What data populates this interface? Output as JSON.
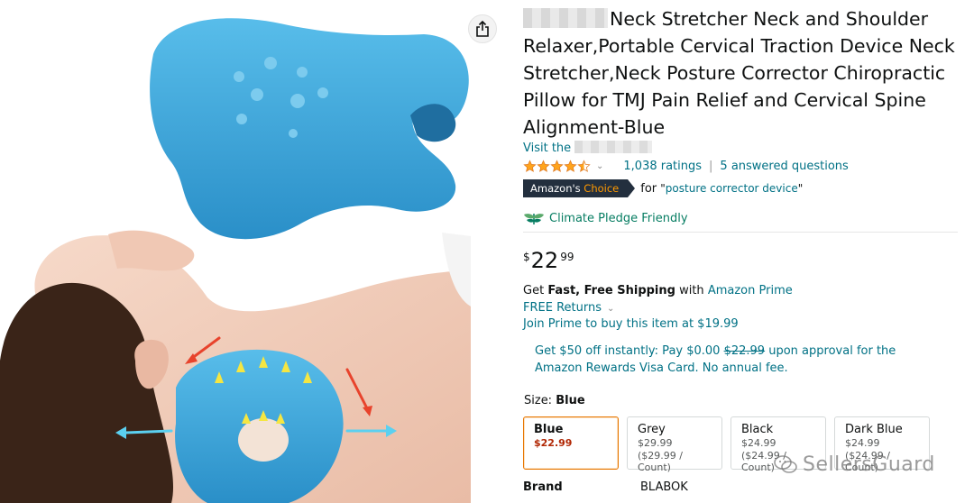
{
  "product": {
    "title": "Neck Stretcher Neck and Shoulder Relaxer,Portable Cervical Traction Device Neck Stretcher,Neck Posture Corrector Chiropractic Pillow for TMJ Pain Relief and Cervical Spine Alignment-Blue",
    "visit_store_prefix": "Visit the",
    "rating_stars": 4.5,
    "ratings_count": "1,038 ratings",
    "answered_questions": "5 answered questions",
    "choice_badge": {
      "prefix": "Amazon's",
      "highlight": "Choice"
    },
    "choice_for": "for",
    "choice_keyword": "posture corrector device",
    "pledge": "Climate Pledge Friendly",
    "price": {
      "symbol": "$",
      "whole": "22",
      "fraction": "99"
    },
    "shipping": {
      "get": "Get",
      "fast_free": "Fast, Free Shipping",
      "with": "with",
      "prime": "Amazon Prime"
    },
    "free_returns": "FREE Returns",
    "join_prime": "Join Prime to buy this item at $19.99",
    "promo": {
      "part1": "Get $50 off instantly: Pay $0.00",
      "strike": "$22.99",
      "part2": "upon approval for the Amazon Rewards Visa Card. No annual fee."
    },
    "size": {
      "label": "Size:",
      "value": "Blue"
    },
    "swatches": [
      {
        "name": "Blue",
        "price": "$22.99",
        "sub": "",
        "selected": true
      },
      {
        "name": "Grey",
        "price": "$29.99",
        "sub": "($29.99 / Count)",
        "selected": false
      },
      {
        "name": "Black",
        "price": "$24.99",
        "sub": "($24.99 / Count)",
        "selected": false
      },
      {
        "name": "Dark Blue",
        "price": "$24.99",
        "sub": "($24.99 / Count)",
        "selected": false
      }
    ],
    "brand": {
      "label": "Brand",
      "value": "BLABOK"
    }
  },
  "watermark": "SellersGuard",
  "colors": {
    "link": "#007185",
    "price_red": "#B12704",
    "star": "#FFA41C",
    "badge_bg": "#232F3E",
    "badge_orange": "#FF9900",
    "pledge_green": "#067D62",
    "product_blue": "#3EA8DC"
  },
  "icons": [
    "share-icon",
    "star-icon",
    "chevron-down-icon",
    "climate-pledge-icon",
    "wechat-icon"
  ]
}
